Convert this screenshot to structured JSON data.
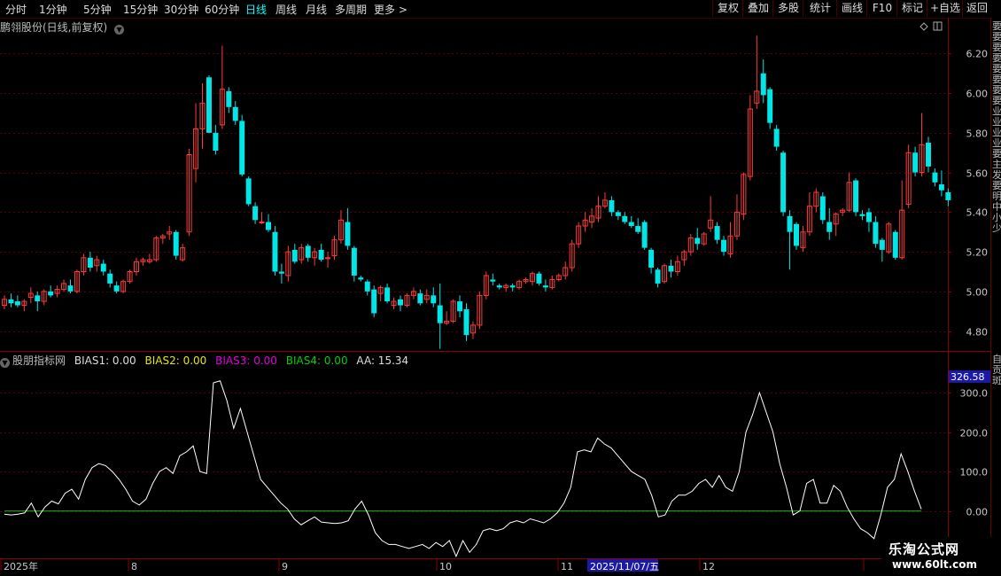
{
  "toolbar": {
    "tabs": [
      "分时",
      "1分钟",
      "5分钟",
      "15分钟",
      "30分钟",
      "60分钟",
      "日线",
      "周线",
      "月线",
      "多周期",
      "更多 >"
    ],
    "active_tab": "日线",
    "right_buttons": [
      "复权",
      "叠加",
      "多股",
      "统计",
      "画线",
      "F10",
      "标记",
      "+自选",
      "返回"
    ]
  },
  "chart_header": {
    "title": "鹏翎股份(日线,前复权)"
  },
  "indicator_header": {
    "name": "股朋指标网",
    "items": [
      {
        "label": "BIAS1: 0.00",
        "color": "#dddddd"
      },
      {
        "label": "BIAS2: 0.00",
        "color": "#e6e600"
      },
      {
        "label": "BIAS3: 0.00",
        "color": "#e000e0"
      },
      {
        "label": "BIAS4: 0.00",
        "color": "#00d000"
      },
      {
        "label": "AA: 15.34",
        "color": "#dddddd"
      }
    ]
  },
  "price_axis_labels": [
    "6.20",
    "6.00",
    "5.80",
    "5.60",
    "5.40",
    "5.20",
    "5.00",
    "4.80"
  ],
  "indicator_axis_labels": [
    "300.0",
    "200.0",
    "100.0",
    "0.00"
  ],
  "indicator_highlight_value": "326.58",
  "time_axis": {
    "labels": [
      "2025年",
      "8",
      "9",
      "10",
      "11",
      "12"
    ],
    "highlight": "2025/11/07/五"
  },
  "right_strip": {
    "top_text": "要要要要要要要要业业业业要主发要明中小少",
    "bottom_text": "自贡斑"
  },
  "logo": {
    "line1": "乐淘公式网",
    "line2": "www.60lt.com"
  },
  "colors": {
    "up": "#ff3b3b",
    "down": "#00e5e5",
    "grid": "#5a0000",
    "line": "#ffffff",
    "zero": "#00c000"
  },
  "chart_data": [
    {
      "type": "candlestick",
      "title": "鹏翎股份(日线,前复权)",
      "ylim": [
        4.7,
        6.3
      ],
      "candles": [
        [
          4.93,
          4.98,
          4.91,
          4.96
        ],
        [
          4.96,
          4.99,
          4.92,
          4.94
        ],
        [
          4.95,
          4.98,
          4.92,
          4.93
        ],
        [
          4.93,
          4.96,
          4.9,
          4.95
        ],
        [
          4.97,
          5.02,
          4.94,
          4.99
        ],
        [
          4.98,
          5.0,
          4.9,
          4.95
        ],
        [
          4.95,
          5.01,
          4.93,
          5.0
        ],
        [
          5.0,
          5.03,
          4.97,
          4.98
        ],
        [
          4.99,
          5.03,
          4.97,
          5.01
        ],
        [
          5.01,
          5.06,
          5.0,
          5.04
        ],
        [
          5.03,
          5.06,
          4.99,
          5.0
        ],
        [
          5.0,
          5.11,
          4.99,
          5.1
        ],
        [
          5.1,
          5.19,
          5.08,
          5.17
        ],
        [
          5.17,
          5.2,
          5.1,
          5.12
        ],
        [
          5.13,
          5.18,
          5.1,
          5.16
        ],
        [
          5.14,
          5.16,
          5.08,
          5.1
        ],
        [
          5.09,
          5.11,
          5.02,
          5.04
        ],
        [
          5.03,
          5.05,
          4.99,
          5.0
        ],
        [
          5.0,
          5.06,
          4.99,
          5.05
        ],
        [
          5.05,
          5.11,
          5.04,
          5.1
        ],
        [
          5.1,
          5.17,
          5.08,
          5.15
        ],
        [
          5.15,
          5.17,
          5.13,
          5.16
        ],
        [
          5.15,
          5.19,
          5.14,
          5.16
        ],
        [
          5.16,
          5.28,
          5.15,
          5.27
        ],
        [
          5.27,
          5.29,
          5.24,
          5.28
        ],
        [
          5.29,
          5.33,
          5.26,
          5.3
        ],
        [
          5.3,
          5.31,
          5.16,
          5.18
        ],
        [
          5.16,
          5.24,
          5.15,
          5.22
        ],
        [
          5.3,
          5.72,
          5.28,
          5.69
        ],
        [
          5.62,
          5.95,
          5.55,
          5.82
        ],
        [
          5.82,
          6.05,
          5.72,
          5.95
        ],
        [
          6.08,
          6.09,
          5.8,
          5.8
        ],
        [
          5.8,
          5.84,
          5.69,
          5.71
        ],
        [
          5.84,
          6.24,
          5.82,
          6.02
        ],
        [
          6.01,
          6.03,
          5.9,
          5.93
        ],
        [
          5.93,
          5.96,
          5.84,
          5.86
        ],
        [
          5.86,
          5.89,
          5.58,
          5.59
        ],
        [
          5.57,
          5.58,
          5.43,
          5.44
        ],
        [
          5.43,
          5.45,
          5.34,
          5.36
        ],
        [
          5.35,
          5.4,
          5.34,
          5.35
        ],
        [
          5.35,
          5.39,
          5.3,
          5.31
        ],
        [
          5.3,
          5.33,
          5.08,
          5.1
        ],
        [
          5.1,
          5.14,
          5.04,
          5.09
        ],
        [
          5.08,
          5.23,
          5.05,
          5.2
        ],
        [
          5.21,
          5.24,
          5.14,
          5.15
        ],
        [
          5.16,
          5.24,
          5.14,
          5.22
        ],
        [
          5.23,
          5.24,
          5.15,
          5.17
        ],
        [
          5.17,
          5.22,
          5.13,
          5.2
        ],
        [
          5.21,
          5.24,
          5.15,
          5.16
        ],
        [
          5.17,
          5.2,
          5.12,
          5.17
        ],
        [
          5.18,
          5.28,
          5.16,
          5.26
        ],
        [
          5.26,
          5.41,
          5.24,
          5.36
        ],
        [
          5.35,
          5.42,
          5.21,
          5.23
        ],
        [
          5.22,
          5.23,
          5.05,
          5.08
        ],
        [
          5.07,
          5.08,
          5.05,
          5.06
        ],
        [
          5.05,
          5.06,
          4.98,
          5.0
        ],
        [
          5.01,
          5.03,
          4.87,
          4.89
        ],
        [
          4.99,
          5.03,
          4.95,
          5.02
        ],
        [
          5.02,
          5.04,
          4.94,
          4.95
        ],
        [
          4.93,
          4.97,
          4.91,
          4.95
        ],
        [
          4.96,
          4.98,
          4.9,
          4.93
        ],
        [
          4.93,
          4.99,
          4.92,
          4.98
        ],
        [
          4.98,
          5.02,
          4.96,
          5.0
        ],
        [
          4.99,
          5.01,
          4.93,
          4.94
        ],
        [
          4.96,
          5.01,
          4.94,
          4.98
        ],
        [
          4.98,
          5.02,
          4.92,
          4.94
        ],
        [
          4.93,
          5.04,
          4.71,
          4.84
        ],
        [
          4.84,
          4.9,
          4.83,
          4.85
        ],
        [
          4.85,
          4.96,
          4.84,
          4.95
        ],
        [
          4.95,
          4.98,
          4.87,
          4.9
        ],
        [
          4.91,
          4.94,
          4.75,
          4.78
        ],
        [
          4.79,
          4.85,
          4.76,
          4.83
        ],
        [
          4.83,
          5.0,
          4.81,
          4.98
        ],
        [
          4.98,
          5.1,
          4.96,
          5.08
        ],
        [
          5.06,
          5.09,
          5.03,
          5.05
        ],
        [
          5.03,
          5.04,
          5.01,
          5.02
        ],
        [
          5.02,
          5.04,
          5.0,
          5.03
        ],
        [
          5.03,
          5.04,
          5.0,
          5.02
        ],
        [
          5.02,
          5.06,
          5.01,
          5.05
        ],
        [
          5.05,
          5.07,
          5.04,
          5.06
        ],
        [
          5.05,
          5.1,
          5.03,
          5.09
        ],
        [
          5.09,
          5.1,
          5.03,
          5.04
        ],
        [
          5.03,
          5.06,
          5.0,
          5.02
        ],
        [
          5.02,
          5.08,
          5.01,
          5.06
        ],
        [
          5.06,
          5.09,
          5.05,
          5.08
        ],
        [
          5.08,
          5.15,
          5.06,
          5.12
        ],
        [
          5.12,
          5.26,
          5.1,
          5.24
        ],
        [
          5.24,
          5.35,
          5.22,
          5.33
        ],
        [
          5.33,
          5.4,
          5.3,
          5.36
        ],
        [
          5.35,
          5.42,
          5.32,
          5.38
        ],
        [
          5.37,
          5.48,
          5.35,
          5.43
        ],
        [
          5.43,
          5.5,
          5.42,
          5.46
        ],
        [
          5.46,
          5.48,
          5.38,
          5.4
        ],
        [
          5.4,
          5.41,
          5.36,
          5.38
        ],
        [
          5.38,
          5.4,
          5.34,
          5.35
        ],
        [
          5.35,
          5.38,
          5.32,
          5.33
        ],
        [
          5.33,
          5.37,
          5.29,
          5.3
        ],
        [
          5.35,
          5.36,
          5.21,
          5.22
        ],
        [
          5.21,
          5.22,
          5.09,
          5.12
        ],
        [
          5.11,
          5.12,
          5.02,
          5.04
        ],
        [
          5.05,
          5.14,
          5.04,
          5.13
        ],
        [
          5.13,
          5.16,
          5.07,
          5.1
        ],
        [
          5.1,
          5.18,
          5.08,
          5.15
        ],
        [
          5.16,
          5.21,
          5.13,
          5.2
        ],
        [
          5.2,
          5.29,
          5.18,
          5.27
        ],
        [
          5.27,
          5.32,
          5.21,
          5.24
        ],
        [
          5.24,
          5.3,
          5.23,
          5.29
        ],
        [
          5.32,
          5.48,
          5.3,
          5.36
        ],
        [
          5.33,
          5.35,
          5.24,
          5.26
        ],
        [
          5.26,
          5.28,
          5.18,
          5.2
        ],
        [
          5.19,
          5.35,
          5.17,
          5.28
        ],
        [
          5.28,
          5.49,
          5.26,
          5.4
        ],
        [
          5.39,
          5.6,
          5.36,
          5.59
        ],
        [
          5.58,
          5.99,
          5.56,
          5.92
        ],
        [
          5.95,
          6.29,
          5.92,
          6.01
        ],
        [
          6.1,
          6.17,
          5.95,
          5.99
        ],
        [
          6.02,
          6.03,
          5.82,
          5.85
        ],
        [
          5.82,
          5.84,
          5.71,
          5.73
        ],
        [
          5.7,
          5.71,
          5.38,
          5.4
        ],
        [
          5.38,
          5.41,
          5.11,
          5.3
        ],
        [
          5.34,
          5.35,
          5.21,
          5.23
        ],
        [
          5.22,
          5.33,
          5.2,
          5.3
        ],
        [
          5.3,
          5.5,
          5.28,
          5.43
        ],
        [
          5.43,
          5.52,
          5.4,
          5.5
        ],
        [
          5.48,
          5.5,
          5.34,
          5.36
        ],
        [
          5.35,
          5.42,
          5.26,
          5.3
        ],
        [
          5.34,
          5.4,
          5.28,
          5.39
        ],
        [
          5.4,
          5.42,
          5.38,
          5.41
        ],
        [
          5.41,
          5.6,
          5.4,
          5.55
        ],
        [
          5.56,
          5.57,
          5.38,
          5.4
        ],
        [
          5.39,
          5.41,
          5.36,
          5.38
        ],
        [
          5.4,
          5.42,
          5.3,
          5.35
        ],
        [
          5.35,
          5.38,
          5.22,
          5.24
        ],
        [
          5.26,
          5.27,
          5.15,
          5.21
        ],
        [
          5.2,
          5.35,
          5.19,
          5.34
        ],
        [
          5.3,
          5.31,
          5.16,
          5.17
        ],
        [
          5.17,
          5.56,
          5.16,
          5.41
        ],
        [
          5.44,
          5.74,
          5.42,
          5.7
        ],
        [
          5.7,
          5.73,
          5.58,
          5.6
        ],
        [
          5.6,
          5.9,
          5.58,
          5.74
        ],
        [
          5.75,
          5.78,
          5.6,
          5.63
        ],
        [
          5.6,
          5.62,
          5.53,
          5.55
        ],
        [
          5.54,
          5.61,
          5.48,
          5.51
        ],
        [
          5.5,
          5.52,
          5.43,
          5.46
        ]
      ]
    },
    {
      "type": "line",
      "title": "股朋指标网",
      "ylim": [
        -120,
        370
      ],
      "series": [
        {
          "name": "BIAS1",
          "values": [
            -8,
            -10,
            -8,
            -5,
            20,
            -15,
            10,
            25,
            18,
            45,
            55,
            30,
            80,
            110,
            120,
            115,
            100,
            80,
            55,
            25,
            15,
            30,
            70,
            100,
            110,
            95,
            140,
            150,
            165,
            100,
            95,
            325,
            330,
            280,
            210,
            260,
            200,
            140,
            80,
            60,
            40,
            20,
            5,
            -20,
            -35,
            -25,
            -15,
            -28,
            -30,
            -32,
            -30,
            -25,
            5,
            25,
            -10,
            -55,
            -75,
            -85,
            -85,
            -90,
            -95,
            -90,
            -85,
            -95,
            -80,
            -90,
            -75,
            -115,
            -75,
            -105,
            -85,
            -50,
            -45,
            -50,
            -45,
            -30,
            -25,
            -30,
            -20,
            -25,
            -30,
            -20,
            -5,
            20,
            60,
            150,
            155,
            150,
            185,
            170,
            160,
            140,
            120,
            100,
            90,
            80,
            40,
            -15,
            -10,
            25,
            40,
            40,
            50,
            70,
            80,
            60,
            90,
            60,
            50,
            100,
            200,
            245,
            300,
            250,
            200,
            120,
            60,
            -10,
            0,
            70,
            80,
            20,
            20,
            65,
            50,
            10,
            -20,
            -45,
            -55,
            -70,
            -10,
            60,
            80,
            145,
            100,
            50,
            5
          ]
        },
        {
          "name": "zero",
          "values": [
            0,
            0
          ]
        }
      ]
    }
  ]
}
